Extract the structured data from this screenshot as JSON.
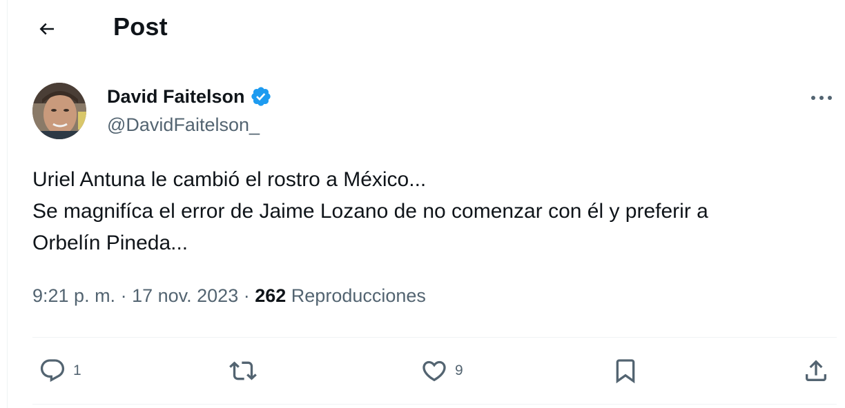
{
  "header": {
    "title": "Post"
  },
  "author": {
    "name": "David Faitelson",
    "handle": "@DavidFaitelson_",
    "verified": true
  },
  "tweet": {
    "text": "Uriel Antuna le cambió el rostro a México...\nSe magnifíca el error de Jaime Lozano de no comenzar con él y preferir a\nOrbelín Pineda...",
    "time": "9:21 p. m.",
    "separator": " · ",
    "date": "17 nov. 2023",
    "views_count": "262",
    "views_label": "Reproducciones"
  },
  "actions": {
    "reply_count": "1",
    "retweet_count": "",
    "like_count": "9"
  },
  "colors": {
    "text": "#0f1419",
    "secondary": "#536471",
    "verified": "#1d9bf0",
    "divider": "#eff3f4"
  },
  "icons": {
    "back": "arrow-left-icon",
    "verified": "verified-badge-icon",
    "more": "more-horizontal-icon",
    "reply": "reply-icon",
    "retweet": "retweet-icon",
    "like": "heart-icon",
    "bookmark": "bookmark-icon",
    "share": "share-icon"
  }
}
